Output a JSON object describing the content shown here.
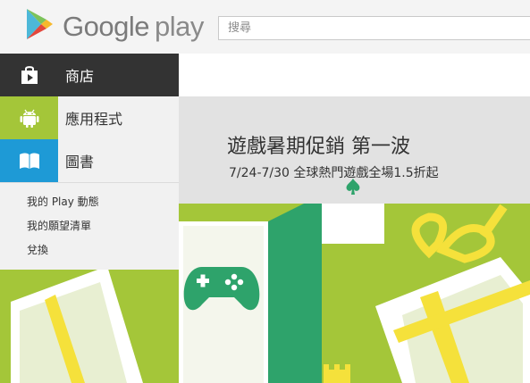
{
  "header": {
    "logo_text": "Google",
    "logo_play": "play",
    "search_placeholder": "搜尋",
    "icons": {
      "logo": "google-play-logo"
    }
  },
  "nav": {
    "items": [
      {
        "label": "商店",
        "icon": "shopping-bag-icon",
        "color": "#333333"
      },
      {
        "label": "應用程式",
        "icon": "android-icon",
        "color": "#a4c639"
      },
      {
        "label": "圖書",
        "icon": "book-icon",
        "color": "#1e9ad6"
      }
    ],
    "links": [
      {
        "label": "我的 Play 動態"
      },
      {
        "label": "我的願望清單"
      },
      {
        "label": "兌換"
      }
    ]
  },
  "hero": {
    "title": "遊戲暑期促銷 第一波",
    "subtitle": "7/24-7/30 全球熱門遊戲全場1.5折起",
    "colors": {
      "background": "#a4c639",
      "band": "#e2e2e2",
      "accent_green": "#2ea36b",
      "ribbon": "#f5e13b"
    }
  }
}
